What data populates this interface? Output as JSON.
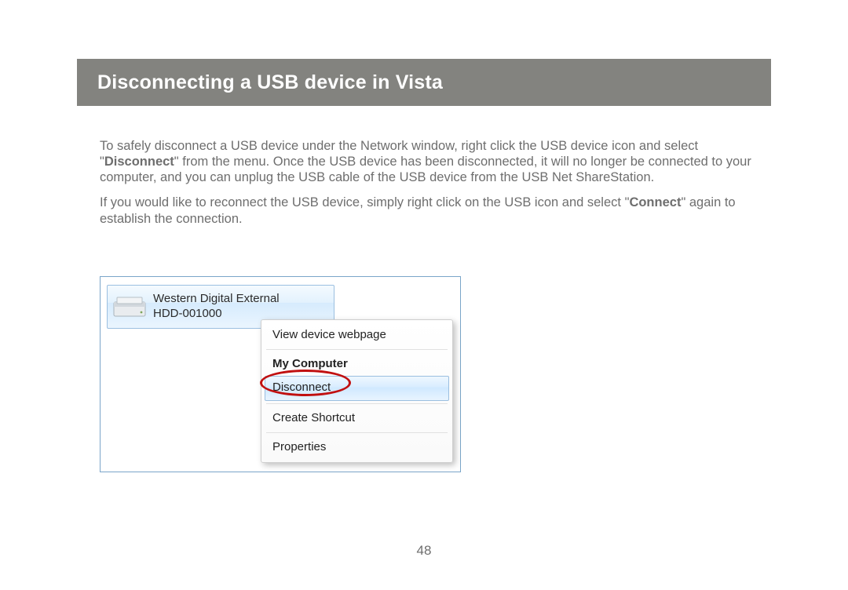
{
  "header": {
    "title": "Disconnecting a USB device in Vista"
  },
  "paragraphs": {
    "p1a": "To safely disconnect a USB device under the Network window, right click the USB device icon and select \"",
    "p1b": "Disconnect",
    "p1c": "\" from the menu. Once the USB device has been disconnected, it will no longer be connected to your computer, and you can unplug the USB cable of the USB device from the USB Net ShareStation.",
    "p2a": "If you would like to reconnect the USB device, simply right click on the USB icon and select \"",
    "p2b": "Connect",
    "p2c": "\" again to establish the connection."
  },
  "device": {
    "name": "Western Digital External\nHDD-001000"
  },
  "context_menu": {
    "items": [
      {
        "label": "View device webpage",
        "bold": false,
        "highlighted": false
      },
      {
        "label": "My Computer",
        "bold": true,
        "highlighted": false
      },
      {
        "label": "Disconnect",
        "bold": false,
        "highlighted": true
      },
      {
        "label": "Create Shortcut",
        "bold": false,
        "highlighted": false
      },
      {
        "label": "Properties",
        "bold": false,
        "highlighted": false
      }
    ]
  },
  "page_number": "48"
}
